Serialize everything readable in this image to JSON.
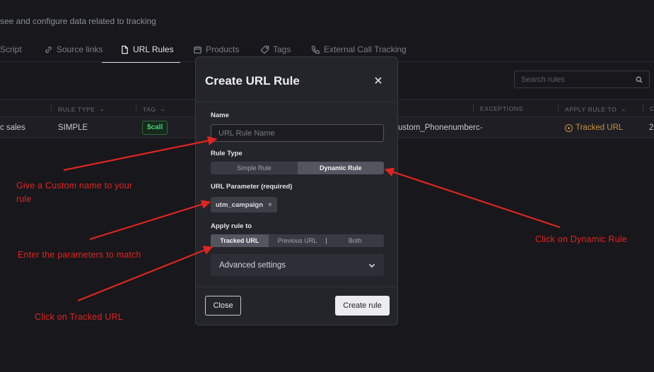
{
  "page": {
    "subtitle": "see and configure data related to tracking"
  },
  "tabs": [
    {
      "label": "Script",
      "icon": "none"
    },
    {
      "label": "Source links",
      "icon": "link-icon"
    },
    {
      "label": "URL Rules",
      "icon": "file-link-icon",
      "active": true
    },
    {
      "label": "Products",
      "icon": "calendar-icon"
    },
    {
      "label": "Tags",
      "icon": "tag-icon"
    },
    {
      "label": "External Call Tracking",
      "icon": "phone-icon"
    }
  ],
  "search": {
    "placeholder": "Search rules"
  },
  "table": {
    "columns": [
      "RULE TYPE",
      "TAG",
      "EXCEPTIONS",
      "APPLY RULE TO",
      "C"
    ],
    "row": {
      "name": "c sales",
      "rule_type": "SIMPLE",
      "tag": "$call",
      "param": "ustom_Phonenumberc",
      "exceptions": "-",
      "apply_to": "Tracked URL",
      "last": "2"
    }
  },
  "modal": {
    "title": "Create URL Rule",
    "name_label": "Name",
    "name_placeholder": "URL Rule Name",
    "rule_type_label": "Rule Type",
    "rule_types": [
      "Simple Rule",
      "Dynamic Rule"
    ],
    "rule_type_selected": "Dynamic Rule",
    "param_label": "URL Parameter (required)",
    "param_chip": "utm_campaign",
    "chip_remove": "×",
    "apply_label": "Apply rule to",
    "apply_options": [
      "Tracked URL",
      "Previous URL",
      "Both"
    ],
    "apply_selected": "Tracked URL",
    "advanced_label": "Advanced settings",
    "close_button": "Close",
    "create_button": "Create rule"
  },
  "annotations": {
    "custom_name": "Give a Custom name to your rule",
    "parameters": "Enter the parameters to match",
    "tracked_url": "Click on Tracked URL",
    "dynamic_rule": "Click on Dynamic Rule"
  },
  "colors": {
    "background": "#17171c",
    "modal": "#24242b",
    "annotation": "#e0251f",
    "tag_green": "#4ccf6f",
    "tracked_orange": "#c8943d"
  }
}
